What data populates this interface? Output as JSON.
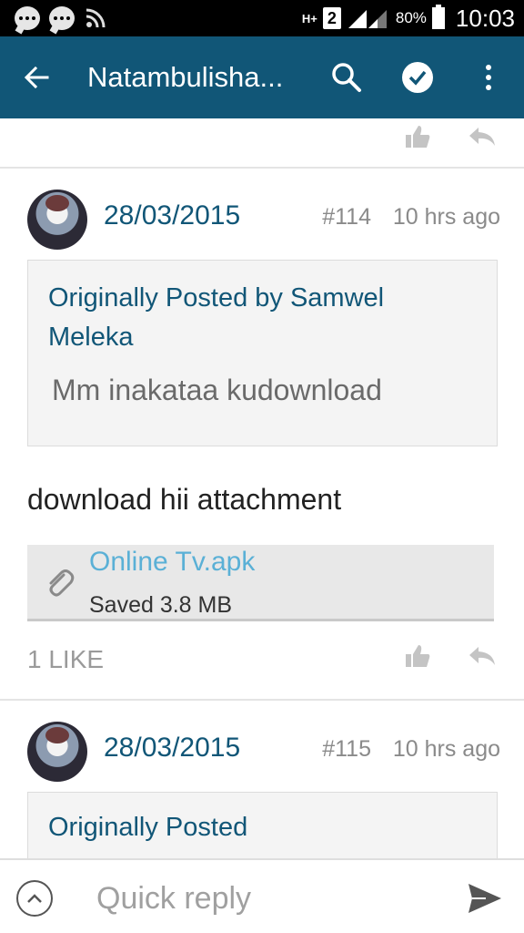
{
  "status_bar": {
    "network_type": "H+",
    "sim_slot": "2",
    "battery_percent": "80%",
    "time": "10:03"
  },
  "app_bar": {
    "title": "Natambulisha...",
    "icons": [
      "back-arrow-icon",
      "search-icon",
      "check-icon",
      "overflow-menu-icon"
    ]
  },
  "posts": [
    {
      "date": "28/03/2015",
      "number": "#114",
      "time_ago": "10 hrs ago",
      "quote": {
        "author": "Originally Posted by Samwel Meleka",
        "text": "Mm inakataa kudownload"
      },
      "body": "download hii attachment",
      "attachment": {
        "name": "Online Tv.apk",
        "size": "Saved 3.8 MB"
      },
      "likes": "1 LIKE"
    },
    {
      "date": "28/03/2015",
      "number": "#115",
      "time_ago": "10 hrs ago",
      "quote": {
        "author": "Originally Posted"
      }
    }
  ],
  "reply_bar": {
    "placeholder": "Quick reply"
  },
  "colors": {
    "app_bar": "#115677",
    "link": "#115677",
    "attachment_link": "#5ab0d6",
    "muted": "#8a8a8a"
  }
}
